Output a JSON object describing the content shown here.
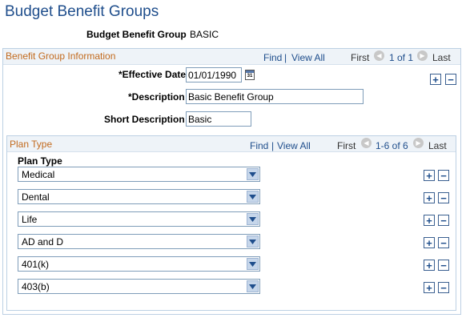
{
  "page": {
    "title": "Budget Benefit Groups"
  },
  "header": {
    "group_label": "Budget Benefit Group",
    "group_value": "BASIC"
  },
  "info_section": {
    "title": "Benefit Group Information",
    "nav": {
      "find": "Find",
      "sep": "|",
      "view_all": "View All",
      "first": "First",
      "range": "1 of 1",
      "last": "Last"
    },
    "effective_date_label": "*Effective Date",
    "effective_date_value": "01/01/1990",
    "calendar_icon_text": "31",
    "description_label": "*Description",
    "description_value": "Basic Benefit Group",
    "short_description_label": "Short Description",
    "short_description_value": "Basic",
    "add_symbol": "+",
    "remove_symbol": "−"
  },
  "plan_section": {
    "title": "Plan Type",
    "nav": {
      "find": "Find",
      "sep": "|",
      "view_all": "View All",
      "first": "First",
      "range": "1-6 of 6",
      "last": "Last"
    },
    "column_header": "Plan Type",
    "rows": [
      {
        "value": "Medical"
      },
      {
        "value": "Dental"
      },
      {
        "value": "Life"
      },
      {
        "value": "AD and D"
      },
      {
        "value": "401(k)"
      },
      {
        "value": "403(b)"
      }
    ],
    "add_symbol": "+",
    "remove_symbol": "−"
  },
  "icons": {
    "prev": "previous-arrow-icon",
    "next": "next-arrow-icon",
    "calendar": "calendar-icon",
    "dropdown": "chevron-down-icon",
    "add": "add-row-icon",
    "remove": "delete-row-icon"
  },
  "colors": {
    "title": "#1f4e8c",
    "section_title": "#c26a1d",
    "border": "#bcd0e3",
    "section_header_bg": "#eef3f8",
    "link": "#1f4e8c"
  }
}
